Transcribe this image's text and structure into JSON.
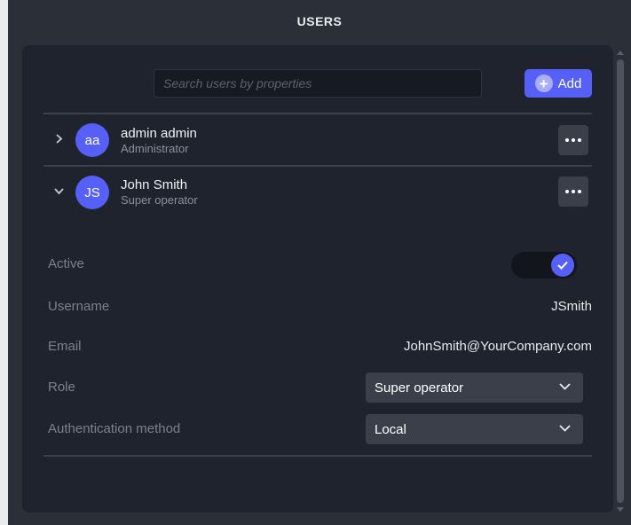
{
  "window": {
    "title": "USERS"
  },
  "search": {
    "placeholder": "Search users by properties",
    "value": ""
  },
  "toolbar": {
    "add_label": "Add"
  },
  "users": [
    {
      "initials": "aa",
      "name": "admin admin",
      "role": "Administrator",
      "expanded": false
    },
    {
      "initials": "JS",
      "name": "John Smith",
      "role": "Super operator",
      "expanded": true
    }
  ],
  "details": {
    "active": {
      "label": "Active",
      "value": true
    },
    "username": {
      "label": "Username",
      "value": "JSmith"
    },
    "email": {
      "label": "Email",
      "value": "JohnSmith@YourCompany.com"
    },
    "role": {
      "label": "Role",
      "value": "Super operator"
    },
    "auth": {
      "label": "Authentication method",
      "value": "Local"
    }
  },
  "icons": {
    "add": "plus-circle-icon",
    "expand": "chevron-right-icon",
    "collapse": "chevron-down-icon",
    "more": "more-horizontal-icon",
    "check": "check-icon",
    "dropdown": "chevron-down-icon"
  },
  "colors": {
    "accent": "#5660f6",
    "panel": "#1f232d",
    "background": "#2b2f38",
    "muted_text": "#7c818d"
  }
}
